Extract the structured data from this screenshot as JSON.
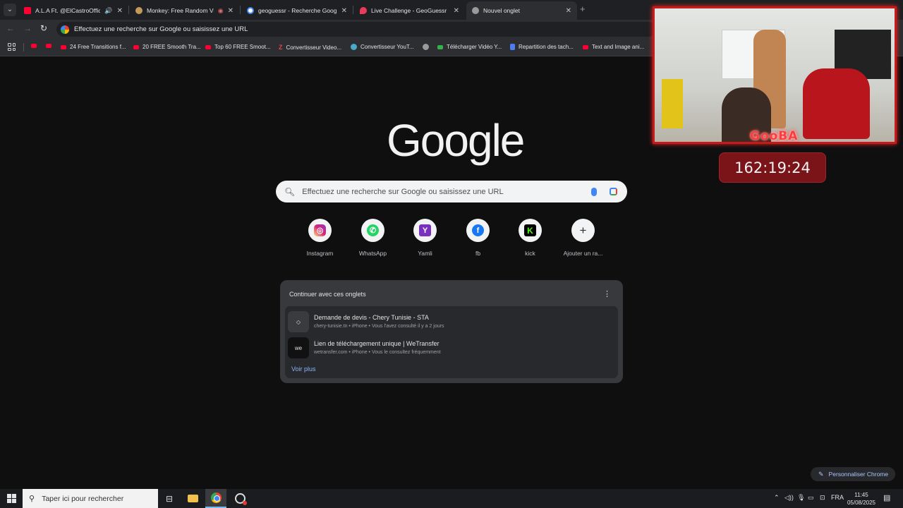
{
  "tabs": [
    {
      "label": "A.L.A Ft. @ElCastroOfficial -",
      "extra": "🔊",
      "close": "✕"
    },
    {
      "label": "Monkey: Free Random Vide",
      "extra": "◉",
      "close": "✕"
    },
    {
      "label": "geoguessr - Recherche Google",
      "close": "✕"
    },
    {
      "label": "Live Challenge - GeoGuessr",
      "close": "✕"
    },
    {
      "label": "Nouvel onglet",
      "close": "✕"
    }
  ],
  "new_tab_glyph": "+",
  "toolbar": {
    "back_glyph": "←",
    "forward_glyph": "→",
    "reload_glyph": "↻",
    "omnibox_text": "Effectuez une recherche sur Google ou saisissez une URL"
  },
  "bookmarks": [
    {
      "label": "",
      "icon": "youtube-icon"
    },
    {
      "label": "",
      "icon": "youtube-icon"
    },
    {
      "label": "24 Free Transitions f...",
      "icon": "youtube-icon"
    },
    {
      "label": "20 FREE Smooth Tra...",
      "icon": "youtube-icon"
    },
    {
      "label": "Top 60 FREE Smoot...",
      "icon": "youtube-icon"
    },
    {
      "label": "Convertisseur Video...",
      "icon": "z-icon"
    },
    {
      "label": "Convertisseur YouT...",
      "icon": "converter-icon"
    },
    {
      "label": "",
      "icon": "globe-icon"
    },
    {
      "label": "Télécharger Vidéo Y...",
      "icon": "download-icon"
    },
    {
      "label": "Repartition des tach...",
      "icon": "doc-icon"
    },
    {
      "label": "Text and Image ani...",
      "icon": "youtube-icon"
    }
  ],
  "ntp": {
    "logo": "Google",
    "search_placeholder": "Effectuez une recherche sur Google ou saisissez une URL",
    "shortcuts": [
      {
        "label": "Instagram",
        "icon": "instagram-icon"
      },
      {
        "label": "WhatsApp",
        "icon": "whatsapp-icon"
      },
      {
        "label": "Yamli",
        "icon": "yamli-icon"
      },
      {
        "label": "fb",
        "icon": "facebook-icon"
      },
      {
        "label": "kick",
        "icon": "kick-icon"
      },
      {
        "label": "Ajouter un ra...",
        "icon": "add-icon"
      }
    ],
    "continue_card": {
      "title": "Continuer avec ces onglets",
      "items": [
        {
          "title": "Demande de devis - Chery Tunisie - STA",
          "subtitle": "chery-tunisie.tn • iPhone • Vous l'avez consulté il y a 2 jours"
        },
        {
          "title": "Lien de téléchargement unique | WeTransfer",
          "subtitle": "wetransfer.com • iPhone • Vous le consultez fréquemment"
        }
      ],
      "more_link": "Voir plus"
    },
    "personalize_label": "Personnaliser Chrome"
  },
  "overlay": {
    "cam_label": "GooBA",
    "timer": "162:19:24"
  },
  "taskbar": {
    "search_placeholder": "Taper ici pour rechercher",
    "language": "FRA",
    "time": "11:45",
    "date": "05/08/2025"
  }
}
